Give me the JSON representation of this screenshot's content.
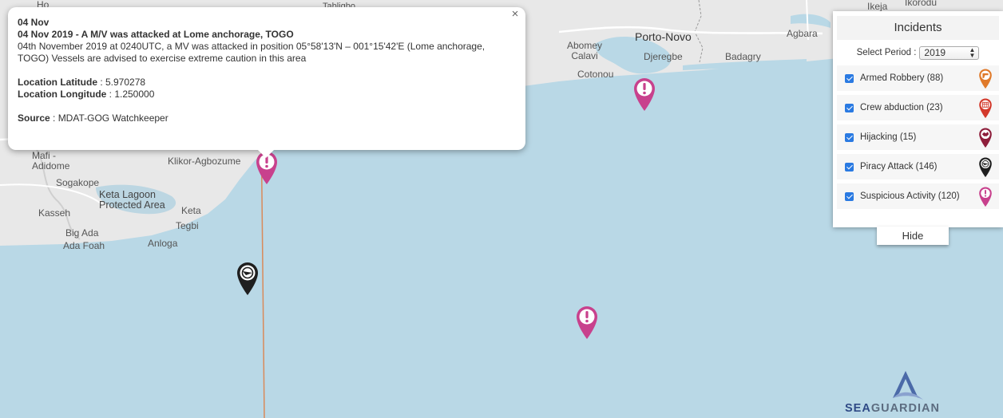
{
  "map": {
    "places": {
      "ho": "Ho",
      "tabligbo": "Tabligbo",
      "mafi_adidome": "Mafi -\nAdidome",
      "klikor": "Klikor-Agbozume",
      "sogakope": "Sogakope",
      "keta_lagoon": "Keta Lagoon\nProtected Area",
      "keta": "Keta",
      "kasseh": "Kasseh",
      "tegbi": "Tegbi",
      "big_ada": "Big Ada",
      "ada_foah": "Ada Foah",
      "anloga": "Anloga",
      "abomey_calavi": "Abomey\nCalavi",
      "porto_novo": "Porto-Novo",
      "djeregbe": "Djeregbe",
      "cotonou": "Cotonou",
      "badagry": "Badagry",
      "agbara": "Agbara",
      "ikeja": "Ikeja",
      "ikorodu": "Ikorodu"
    },
    "colors": {
      "sea": "#b9d8e6",
      "land": "#e9e9e9",
      "marker_suspicious": "#c8418d",
      "marker_piracy": "#1f1f1f",
      "track": "#d98a5a"
    }
  },
  "popup": {
    "close_label": "×",
    "date": "04 Nov",
    "headline": "04 Nov 2019 - A M/V was attacked at Lome anchorage, TOGO",
    "body": "04th November 2019 at 0240UTC, a MV was attacked in position 05°58'13'N – 001°15'42'E (Lome anchorage, TOGO) Vessels are advised to exercise extreme caution in this area",
    "lat_label": "Location Latitude",
    "lat_value": " : 5.970278",
    "lon_label": "Location Longitude",
    "lon_value": " : 1.250000",
    "source_label": "Source",
    "source_value": " : MDAT-GOG Watchkeeper"
  },
  "panel": {
    "title": "Incidents",
    "period_label": "Select Period :",
    "period_value": "2019",
    "categories": [
      {
        "label": "Armed Robbery (88)",
        "icon": "armed-robbery-icon",
        "color": "#e07a2a",
        "checked": true
      },
      {
        "label": "Crew abduction (23)",
        "icon": "crew-abduction-icon",
        "color": "#d33a2c",
        "checked": true
      },
      {
        "label": "Hijacking (15)",
        "icon": "hijacking-icon",
        "color": "#8e1e3b",
        "checked": true
      },
      {
        "label": "Piracy Attack (146)",
        "icon": "piracy-attack-icon",
        "color": "#1f1f1f",
        "checked": true
      },
      {
        "label": "Suspicious Activity (120)",
        "icon": "suspicious-activity-icon",
        "color": "#c8418d",
        "checked": true
      }
    ],
    "hide_label": "Hide"
  },
  "logo": {
    "text_sea": "SEA",
    "text_guardian": "GUARDIAN"
  }
}
